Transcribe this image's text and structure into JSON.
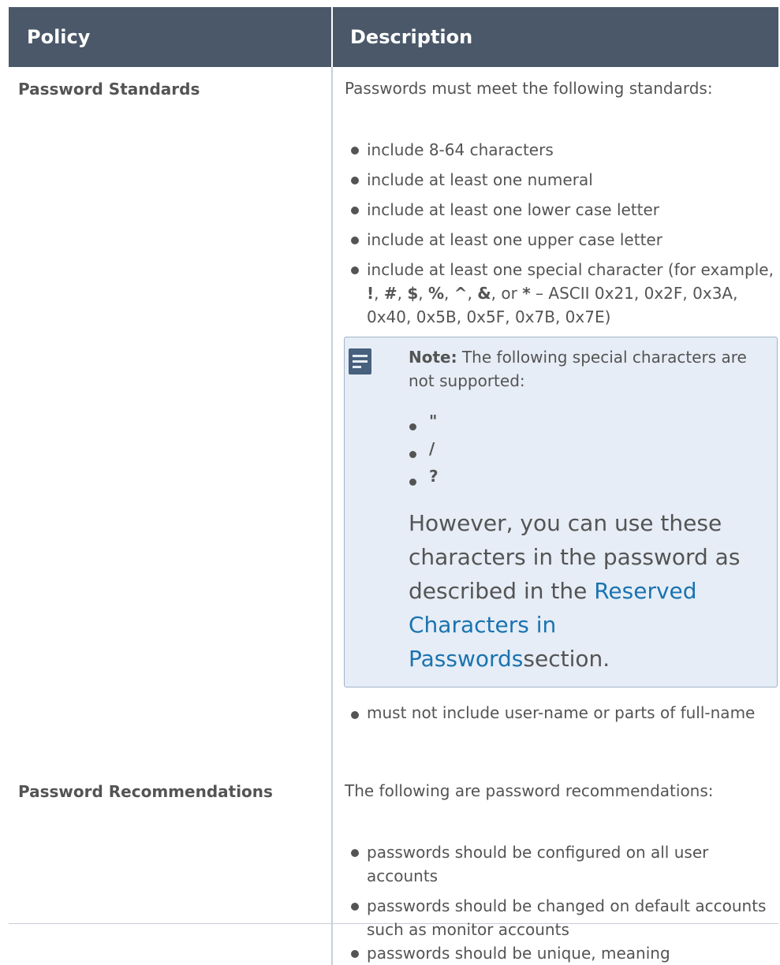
{
  "header": {
    "policy_label": "Policy",
    "description_label": "Description"
  },
  "rows": [
    {
      "policy": "Password Standards",
      "intro": "Passwords must meet the following standards:",
      "items": [
        "include 8-64 characters",
        "include at least one numeral",
        "include at least one lower case letter",
        "include at least one upper case letter"
      ],
      "special": {
        "prefix": "include at least one special character (for example, ",
        "chars": [
          "!",
          "#",
          "$",
          "%",
          "^",
          "&",
          "*"
        ],
        "suffix": " – ASCII 0x21, 0x2F, 0x3A, 0x40, 0x5B, 0x5F, 0x7B, 0x7E)",
        "or_word": "or"
      },
      "note": {
        "label": "Note:",
        "text": " The following special characters are not supported:",
        "chars": [
          "\"",
          "/",
          "?"
        ],
        "body_before": "However, you can use these characters in the password as described in the ",
        "link_text": "Reserved Characters in Passwords",
        "body_after": "section."
      },
      "last_item": "must not include user-name or parts of full-name"
    },
    {
      "policy": "Password Recommendations",
      "intro": "The following are password recommendations:",
      "items": [
        "passwords should be configured on all user accounts",
        "passwords should be changed on default accounts such as monitor accounts",
        "passwords should be unique, meaning"
      ]
    }
  ],
  "icons": {
    "note_icon": "note-icon"
  },
  "colors": {
    "header_bg": "#4a5869",
    "note_bg": "#e6edf6",
    "link": "#1a73b0"
  }
}
